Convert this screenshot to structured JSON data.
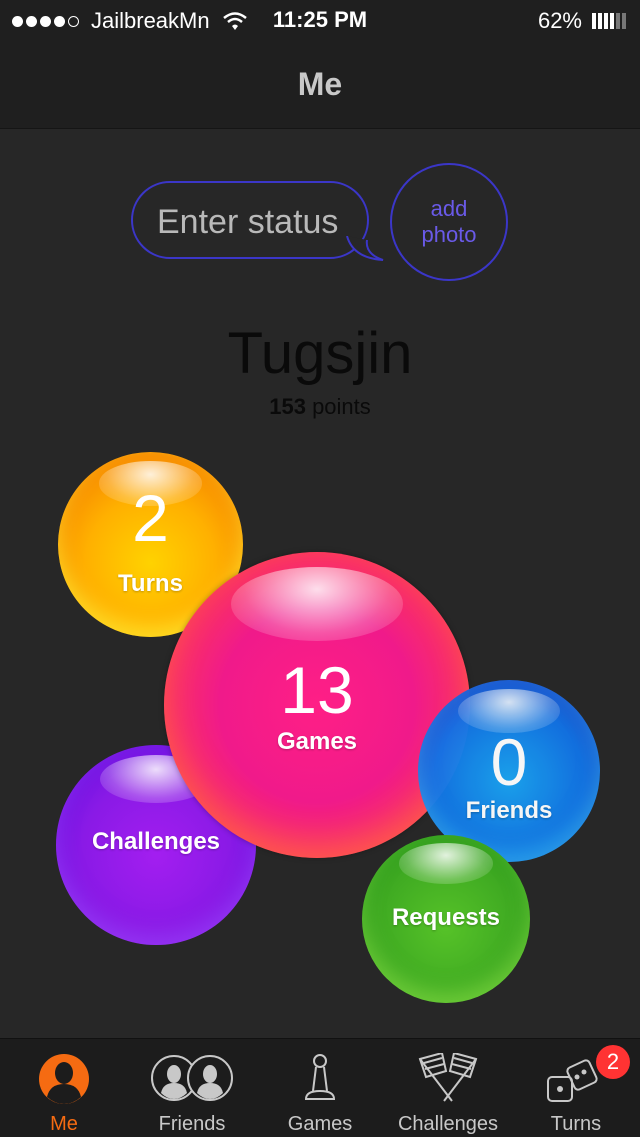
{
  "status_bar": {
    "carrier": "JailbreakMn",
    "time": "11:25 PM",
    "battery": "62%"
  },
  "nav": {
    "title": "Me"
  },
  "status": {
    "placeholder": "Enter status"
  },
  "add_photo": {
    "line1": "add",
    "line2": "photo"
  },
  "profile": {
    "name": "Tugsjin",
    "points_value": "153",
    "points_label": "points"
  },
  "stats": {
    "turns": {
      "count": "2",
      "label": "Turns"
    },
    "games": {
      "count": "13",
      "label": "Games"
    },
    "friends": {
      "count": "0",
      "label": "Friends"
    },
    "challenges": {
      "label": "Challenges"
    },
    "requests": {
      "label": "Requests"
    }
  },
  "tabs": [
    {
      "label": "Me",
      "icon": "person-icon",
      "active": true
    },
    {
      "label": "Friends",
      "icon": "friends-icon"
    },
    {
      "label": "Games",
      "icon": "pawn-icon"
    },
    {
      "label": "Challenges",
      "icon": "flags-icon"
    },
    {
      "label": "Turns",
      "icon": "dice-icon",
      "badge": "2"
    }
  ],
  "colors": {
    "accent": "#f56b12",
    "outline": "#3b36c8",
    "badge": "#ff3333"
  }
}
